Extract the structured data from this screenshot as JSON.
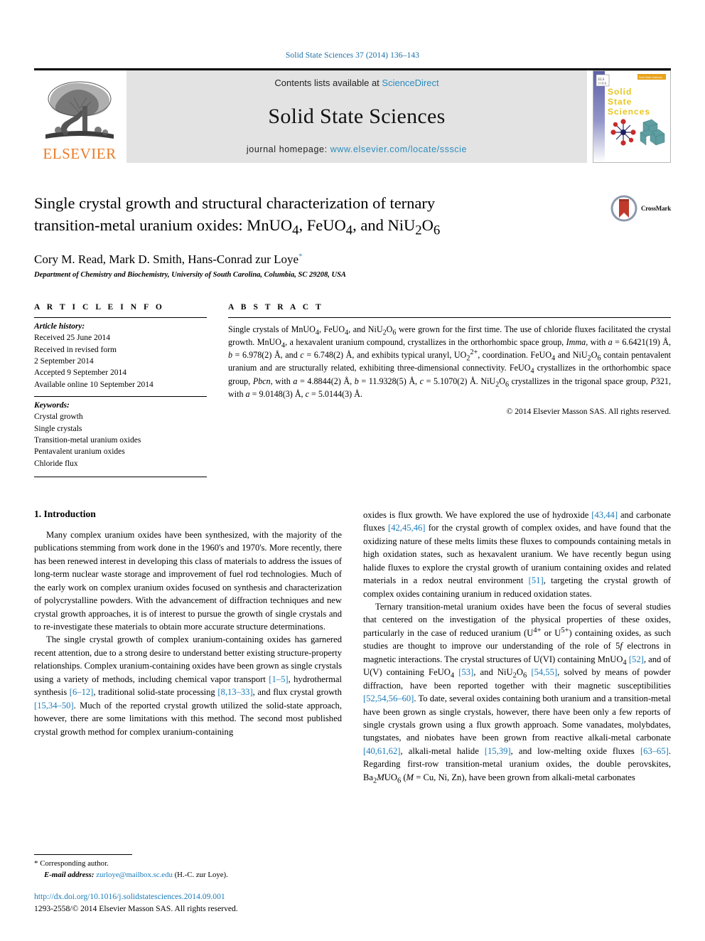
{
  "running_head": "Solid State Sciences 37 (2014) 136–143",
  "masthead": {
    "publisher_wordmark": "ELSEVIER",
    "contents_prefix": "Contents lists available at ",
    "contents_link": "ScienceDirect",
    "journal_name": "Solid State Sciences",
    "homepage_prefix": "journal homepage: ",
    "homepage_url": "www.elsevier.com/locate/ssscie",
    "cover": {
      "line1": "Solid",
      "line2": "State",
      "line3": "Sciences"
    },
    "accent_link_color": "#2b8cbe",
    "elsevier_orange": "#ea7a24"
  },
  "article": {
    "title_line1": "Single crystal growth and structural characterization of ternary",
    "title_line2_pre": "transition-metal uranium oxides: MnUO",
    "title_line2_sub1": "4",
    "title_line2_mid": ", FeUO",
    "title_line2_sub2": "4",
    "title_line2_mid2": ", and NiU",
    "title_line2_sub3": "2",
    "title_line2_end": "O",
    "title_line2_sub4": "6",
    "authors": "Cory M. Read, Mark D. Smith, Hans-Conrad zur Loye",
    "author_marker": "*",
    "affiliation": "Department of Chemistry and Biochemistry, University of South Carolina, Columbia, SC 29208, USA",
    "crossmark_label": "CrossMark"
  },
  "article_info": {
    "heading": "A R T I C L E  I N F O",
    "history_label": "Article history:",
    "history": [
      "Received 25 June 2014",
      "Received in revised form",
      "2 September 2014",
      "Accepted 9 September 2014",
      "Available online 10 September 2014"
    ],
    "keywords_label": "Keywords:",
    "keywords": [
      "Crystal growth",
      "Single crystals",
      "Transition-metal uranium oxides",
      "Pentavalent uranium oxides",
      "Chloride flux"
    ]
  },
  "abstract": {
    "heading": "A B S T R A C T",
    "copyright": "© 2014 Elsevier Masson SAS. All rights reserved."
  },
  "body": {
    "section_heading": "1. Introduction",
    "left_paragraph_1": "Many complex uranium oxides have been synthesized, with the majority of the publications stemming from work done in the 1960's and 1970's. More recently, there has been renewed interest in developing this class of materials to address the issues of long-term nuclear waste storage and improvement of fuel rod technologies. Much of the early work on complex uranium oxides focused on synthesis and characterization of polycrystalline powders. With the advancement of diffraction techniques and new crystal growth approaches, it is of interest to pursue the growth of single crystals and to re-investigate these materials to obtain more accurate structure determinations."
  },
  "footnote": {
    "corresponding": "Corresponding author.",
    "email_label": "E-mail address:",
    "email": "zurloye@mailbox.sc.edu",
    "email_suffix": "(H.-C. zur Loye).",
    "doi": "http://dx.doi.org/10.1016/j.solidstatesciences.2014.09.001",
    "issn": "1293-2558/© 2014 Elsevier Masson SAS. All rights reserved."
  }
}
